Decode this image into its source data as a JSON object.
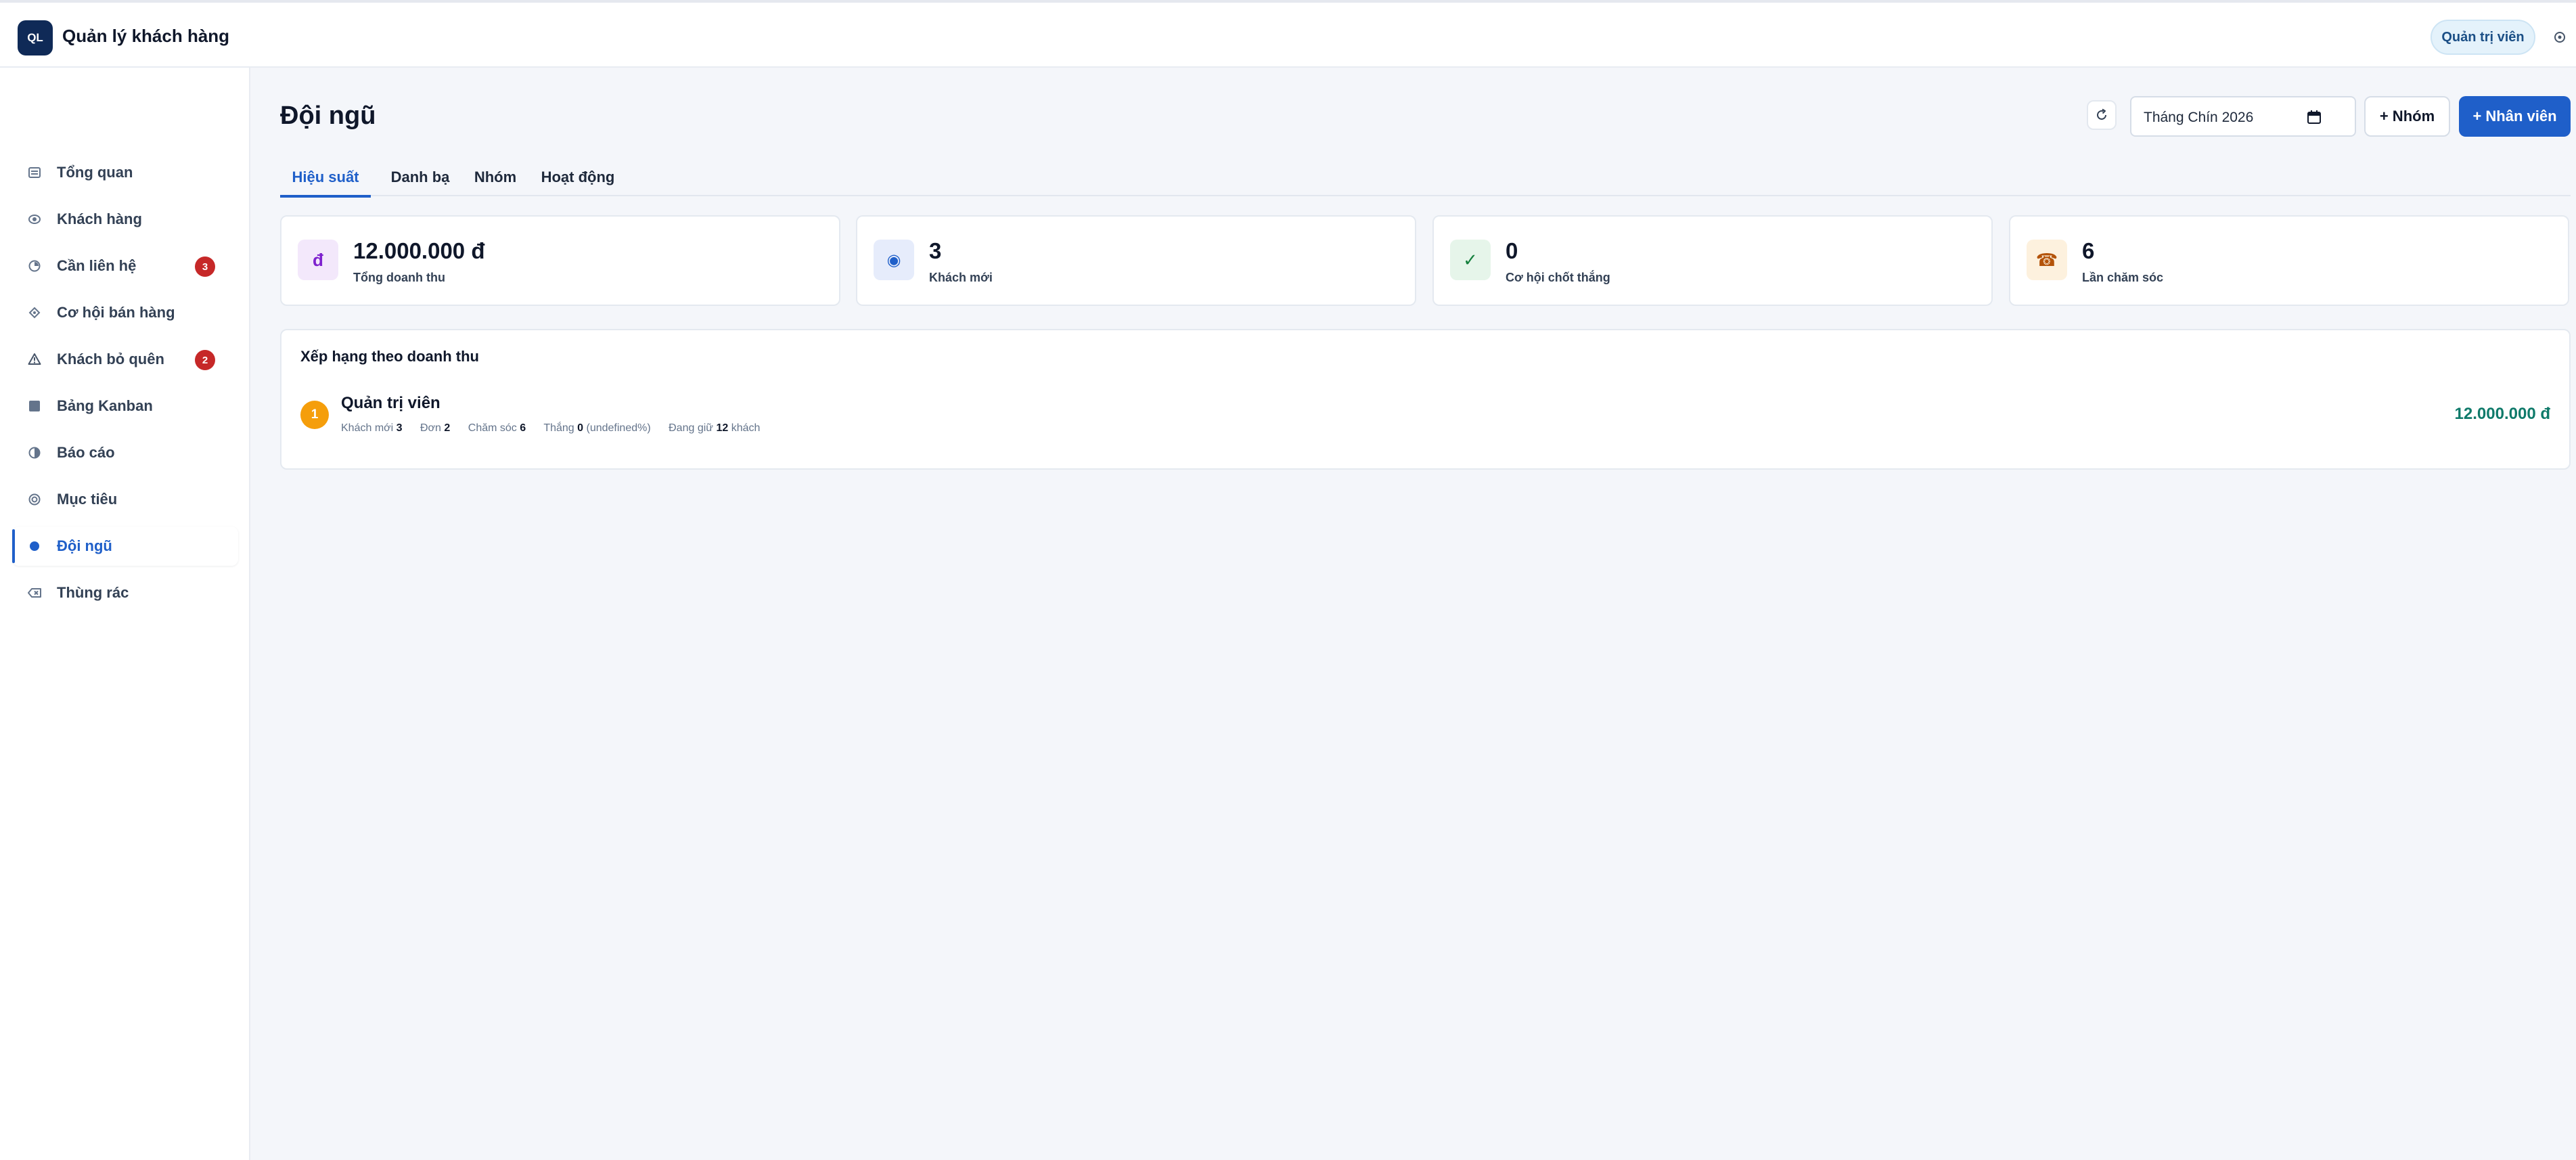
{
  "app": {
    "logo_text": "QL",
    "title": "Quản lý khách hàng",
    "role_label": "Quản trị viên",
    "settings_icon": "gear-icon"
  },
  "sidebar": {
    "items": [
      {
        "label": "Tổng quan",
        "icon": "overview-icon",
        "badge": ""
      },
      {
        "label": "Khách hàng",
        "icon": "customers-icon",
        "badge": ""
      },
      {
        "label": "Cần liên hệ",
        "icon": "clock-icon",
        "badge": "3"
      },
      {
        "label": "Cơ hội bán hàng",
        "icon": "target-icon",
        "badge": ""
      },
      {
        "label": "Khách bỏ quên",
        "icon": "warning-icon",
        "badge": "2"
      },
      {
        "label": "Bảng Kanban",
        "icon": "kanban-icon",
        "badge": ""
      },
      {
        "label": "Báo cáo",
        "icon": "report-icon",
        "badge": ""
      },
      {
        "label": "Mục tiêu",
        "icon": "goal-icon",
        "badge": ""
      },
      {
        "label": "Đội ngũ",
        "icon": "team-icon",
        "badge": "",
        "active": true
      },
      {
        "label": "Thùng rác",
        "icon": "trash-icon",
        "badge": ""
      }
    ]
  },
  "header": {
    "title": "Đội ngũ",
    "month_value": "Tháng Chín 2026",
    "add_group_label": "+ Nhóm",
    "add_staff_label": "+ Nhân viên"
  },
  "tabs": [
    {
      "label": "Hiệu suất",
      "active": true
    },
    {
      "label": "Danh bạ"
    },
    {
      "label": "Nhóm"
    },
    {
      "label": "Hoạt động"
    }
  ],
  "kpis": [
    {
      "value": "12.000.000 đ",
      "label": "Tổng doanh thu",
      "icon": "currency-icon",
      "glyph": "đ",
      "icon_bg": "#f3e8fb",
      "icon_color": "#7e22ce"
    },
    {
      "value": "3",
      "label": "Khách mới",
      "icon": "new-customer-icon",
      "glyph": "◉",
      "icon_bg": "#e6ecfb",
      "icon_color": "#1f5fc9"
    },
    {
      "value": "0",
      "label": "Cơ hội chốt thắng",
      "icon": "check-icon",
      "glyph": "✓",
      "icon_bg": "#e6f5ea",
      "icon_color": "#15803d"
    },
    {
      "value": "6",
      "label": "Lần chăm sóc",
      "icon": "phone-icon",
      "glyph": "☎",
      "icon_bg": "#fdf1de",
      "icon_color": "#b45309"
    }
  ],
  "ranking": {
    "title": "Xếp hạng theo doanh thu",
    "rows": [
      {
        "rank": "1",
        "name": "Quản trị viên",
        "amount": "12.000.000 đ",
        "stats": [
          {
            "label": "Khách mới",
            "value": "3",
            "suffix": ""
          },
          {
            "label": "Đơn",
            "value": "2",
            "suffix": ""
          },
          {
            "label": "Chăm sóc",
            "value": "6",
            "suffix": ""
          },
          {
            "label": "Thắng",
            "value": "0",
            "suffix": "(undefined%)"
          },
          {
            "label": "Đang giữ",
            "value": "12",
            "suffix": "khách"
          }
        ]
      }
    ]
  }
}
